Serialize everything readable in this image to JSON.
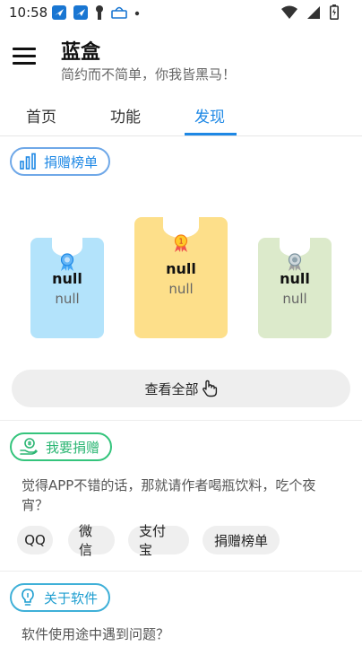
{
  "status_bar": {
    "time": "10:58"
  },
  "app": {
    "title": "蓝盒",
    "subtitle": "简约而不简单，你我皆黑马！"
  },
  "tabs": [
    {
      "label": "首页"
    },
    {
      "label": "功能"
    },
    {
      "label": "发现"
    }
  ],
  "donation_ranking": {
    "heading": "捐赠榜单",
    "cards": [
      {
        "name": "null",
        "amount": "null"
      },
      {
        "name": "null",
        "amount": "null"
      },
      {
        "name": "null",
        "amount": "null"
      }
    ],
    "view_all_label": "查看全部"
  },
  "donate": {
    "heading": "我要捐赠",
    "description": "觉得APP不错的话，那就请作者喝瓶饮料，吃个夜宵？",
    "options": [
      {
        "label": "QQ"
      },
      {
        "label": "微信"
      },
      {
        "label": "支付宝"
      },
      {
        "label": "捐赠榜单"
      }
    ]
  },
  "about": {
    "heading": "关于软件",
    "description": "软件使用途中遇到问题？"
  },
  "colors": {
    "accent_blue": "#1e88e5",
    "donate_green": "#2bb673",
    "card_blue": "#b3e3fb",
    "card_yellow": "#fddf8a",
    "card_green": "#dceacb"
  }
}
